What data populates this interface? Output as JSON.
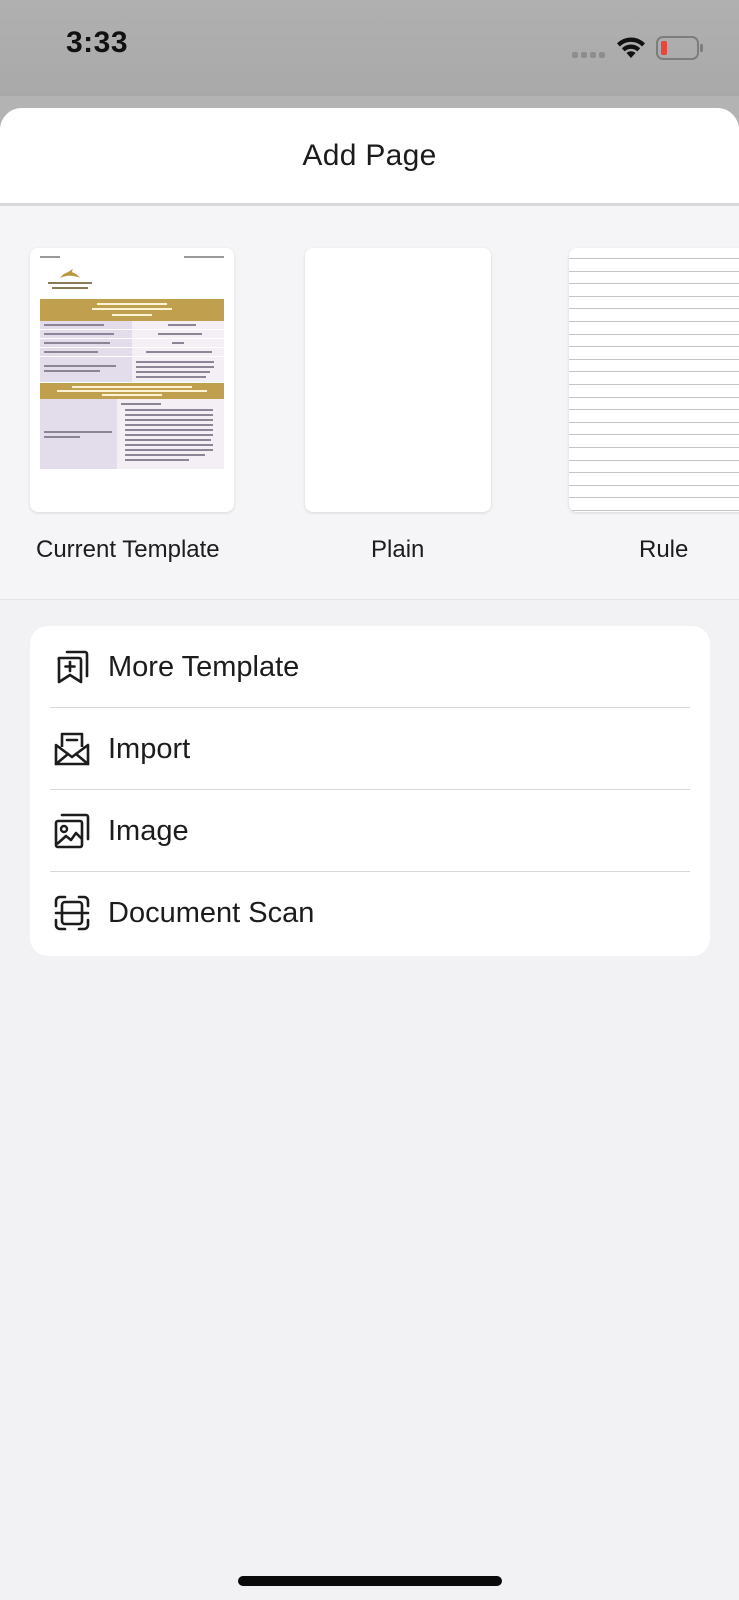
{
  "status_bar": {
    "time": "3:33",
    "battery_color": "#e8453c"
  },
  "sheet": {
    "title": "Add Page"
  },
  "templates": [
    {
      "label": "Current Template",
      "preview": "document"
    },
    {
      "label": "Plain",
      "preview": "blank"
    },
    {
      "label": "Rule",
      "preview": "ruled-lines"
    }
  ],
  "menu": {
    "items": [
      {
        "label": "More Template",
        "icon": "add-template-icon"
      },
      {
        "label": "Import",
        "icon": "import-envelope-icon"
      },
      {
        "label": "Image",
        "icon": "image-icon"
      },
      {
        "label": "Document Scan",
        "icon": "document-scan-icon"
      }
    ]
  },
  "colors": {
    "accent_gold": "#c0a04f",
    "sheet_bg": "#f2f2f4",
    "card_bg": "#ffffff",
    "text": "#1c1c1e"
  }
}
